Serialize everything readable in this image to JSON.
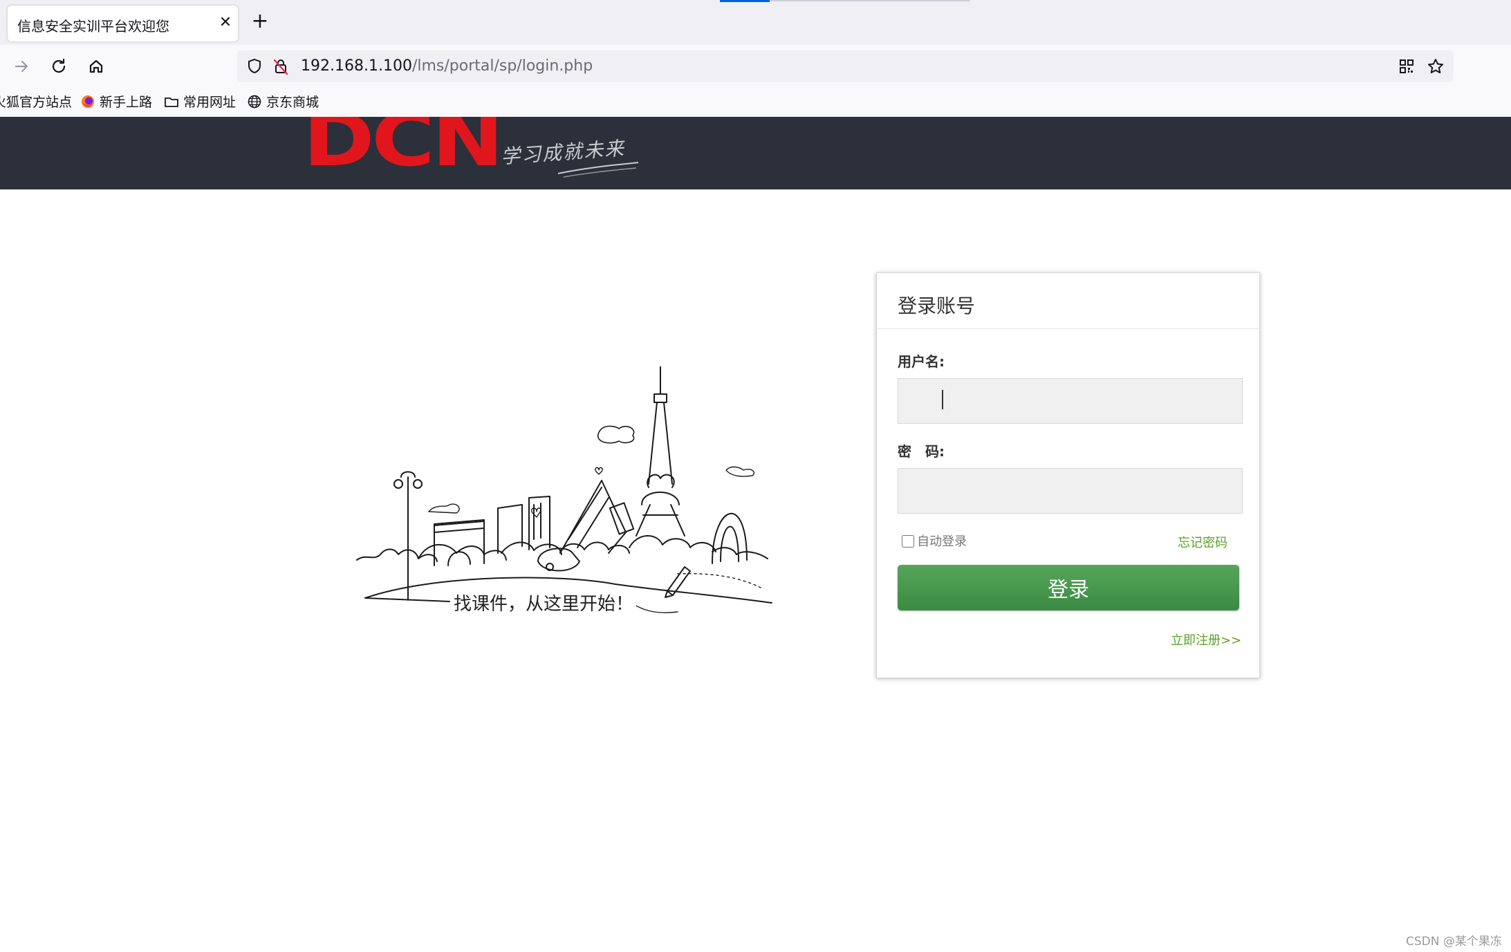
{
  "browser": {
    "tab": {
      "title": "信息安全实训平台欢迎您",
      "close_icon": "close-icon"
    },
    "new_tab_icon": "plus-icon",
    "nav": {
      "forward_icon": "arrow-right-icon",
      "reload_icon": "reload-icon",
      "home_icon": "home-icon"
    },
    "url": {
      "host": "192.168.1.100",
      "path": "/lms/portal/sp/login.php"
    },
    "bookmarks": [
      {
        "label": "火狐官方站点",
        "icon": "firefox-icon"
      },
      {
        "label": "新手上路",
        "icon": "firefox-icon"
      },
      {
        "label": "常用网址",
        "icon": "folder-icon"
      },
      {
        "label": "京东商城",
        "icon": "globe-icon"
      }
    ]
  },
  "header": {
    "logo": "DCN",
    "slogan": "学习成就未来"
  },
  "illustration": {
    "caption": "找课件，从这里开始！"
  },
  "login": {
    "title": "登录账号",
    "username_label": "用户名:",
    "username_value": "",
    "password_label": "密　码:",
    "password_value": "",
    "remember_label": "自动登录",
    "remember_checked": false,
    "forgot_label": "忘记密码",
    "submit_label": "登录",
    "register_label": "立即注册>>"
  },
  "colors": {
    "header_bg": "#2b303a",
    "logo_red": "#e1161c",
    "accent_green": "#5aa127",
    "button_green": "#4a9a51"
  },
  "watermark": "CSDN @某个果冻"
}
